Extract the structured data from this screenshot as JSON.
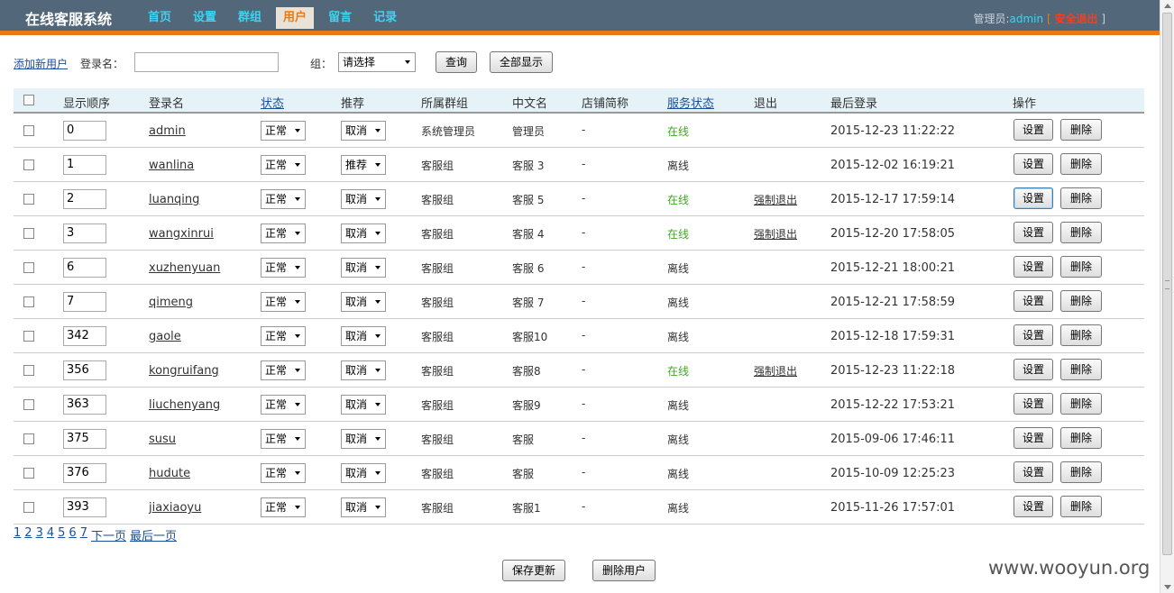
{
  "header": {
    "app_title": "在线客服系统",
    "nav": [
      "首页",
      "设置",
      "群组",
      "用户",
      "留言",
      "记录"
    ],
    "active_nav": "用户",
    "admin_label": "管理员:",
    "admin_name": "admin",
    "bracket_open": "[",
    "logout": "安全退出",
    "bracket_close": "]"
  },
  "filter": {
    "add_user": "添加新用户",
    "login_label": "登录名：",
    "login_value": "",
    "group_label": "组：",
    "group_selected": "请选择",
    "query_btn": "查询",
    "show_all_btn": "全部显示"
  },
  "table": {
    "headers": [
      "显示顺序",
      "登录名",
      "状态",
      "推荐",
      "所属群组",
      "中文名",
      "店铺简称",
      "服务状态",
      "退出",
      "最后登录",
      "操作"
    ],
    "set_btn": "设置",
    "del_btn": "删除",
    "rows": [
      {
        "order": "0",
        "login": "admin",
        "status": "正常",
        "rec": "取消",
        "group": "系统管理员",
        "cname": "管理员",
        "shop": "-",
        "svc": "在线",
        "quit": "",
        "last": "2015-12-23 11:22:22"
      },
      {
        "order": "1",
        "login": "wanlina",
        "status": "正常",
        "rec": "推荐",
        "group": "客服组",
        "cname": "客服 3",
        "shop": "-",
        "svc": "离线",
        "quit": "",
        "last": "2015-12-02 16:19:21"
      },
      {
        "order": "2",
        "login": "luanqing",
        "status": "正常",
        "rec": "取消",
        "group": "客服组",
        "cname": "客服 5",
        "shop": "-",
        "svc": "在线",
        "quit": "强制退出",
        "last": "2015-12-17 17:59:14"
      },
      {
        "order": "3",
        "login": "wangxinrui",
        "status": "正常",
        "rec": "取消",
        "group": "客服组",
        "cname": "客服 4",
        "shop": "-",
        "svc": "在线",
        "quit": "强制退出",
        "last": "2015-12-20 17:58:05"
      },
      {
        "order": "6",
        "login": "xuzhenyuan",
        "status": "正常",
        "rec": "取消",
        "group": "客服组",
        "cname": "客服 6",
        "shop": "-",
        "svc": "离线",
        "quit": "",
        "last": "2015-12-21 18:00:21"
      },
      {
        "order": "7",
        "login": "qimeng",
        "status": "正常",
        "rec": "取消",
        "group": "客服组",
        "cname": "客服 7",
        "shop": "-",
        "svc": "离线",
        "quit": "",
        "last": "2015-12-21 17:58:59"
      },
      {
        "order": "342",
        "login": "gaole",
        "status": "正常",
        "rec": "取消",
        "group": "客服组",
        "cname": "客服10",
        "shop": "-",
        "svc": "离线",
        "quit": "",
        "last": "2015-12-18 17:59:31"
      },
      {
        "order": "356",
        "login": "kongruifang",
        "status": "正常",
        "rec": "取消",
        "group": "客服组",
        "cname": "客服8",
        "shop": "-",
        "svc": "在线",
        "quit": "强制退出",
        "last": "2015-12-23 11:22:18"
      },
      {
        "order": "363",
        "login": "liuchenyang",
        "status": "正常",
        "rec": "取消",
        "group": "客服组",
        "cname": "客服9",
        "shop": "-",
        "svc": "离线",
        "quit": "",
        "last": "2015-12-22 17:53:21"
      },
      {
        "order": "375",
        "login": "susu",
        "status": "正常",
        "rec": "取消",
        "group": "客服组",
        "cname": "客服",
        "shop": "-",
        "svc": "离线",
        "quit": "",
        "last": "2015-09-06 17:46:11"
      },
      {
        "order": "376",
        "login": "hudute",
        "status": "正常",
        "rec": "取消",
        "group": "客服组",
        "cname": "客服",
        "shop": "-",
        "svc": "离线",
        "quit": "",
        "last": "2015-10-09 12:25:23"
      },
      {
        "order": "393",
        "login": "jiaxiaoyu",
        "status": "正常",
        "rec": "取消",
        "group": "客服组",
        "cname": "客服1",
        "shop": "-",
        "svc": "离线",
        "quit": "",
        "last": "2015-11-26 17:57:01"
      }
    ]
  },
  "pager": {
    "pages": [
      "1",
      "2",
      "3",
      "4",
      "5",
      "6",
      "7"
    ],
    "next": "下一页",
    "last": "最后一页"
  },
  "footer": {
    "save_btn": "保存更新",
    "delete_btn": "删除用户"
  },
  "watermark": "www.wooyun.org",
  "colors": {
    "header_bg": "#53677a",
    "accent_orange": "#e87a15",
    "nav_text": "#3cd4f2",
    "online": "#43a626",
    "link": "#1a4f9c"
  }
}
